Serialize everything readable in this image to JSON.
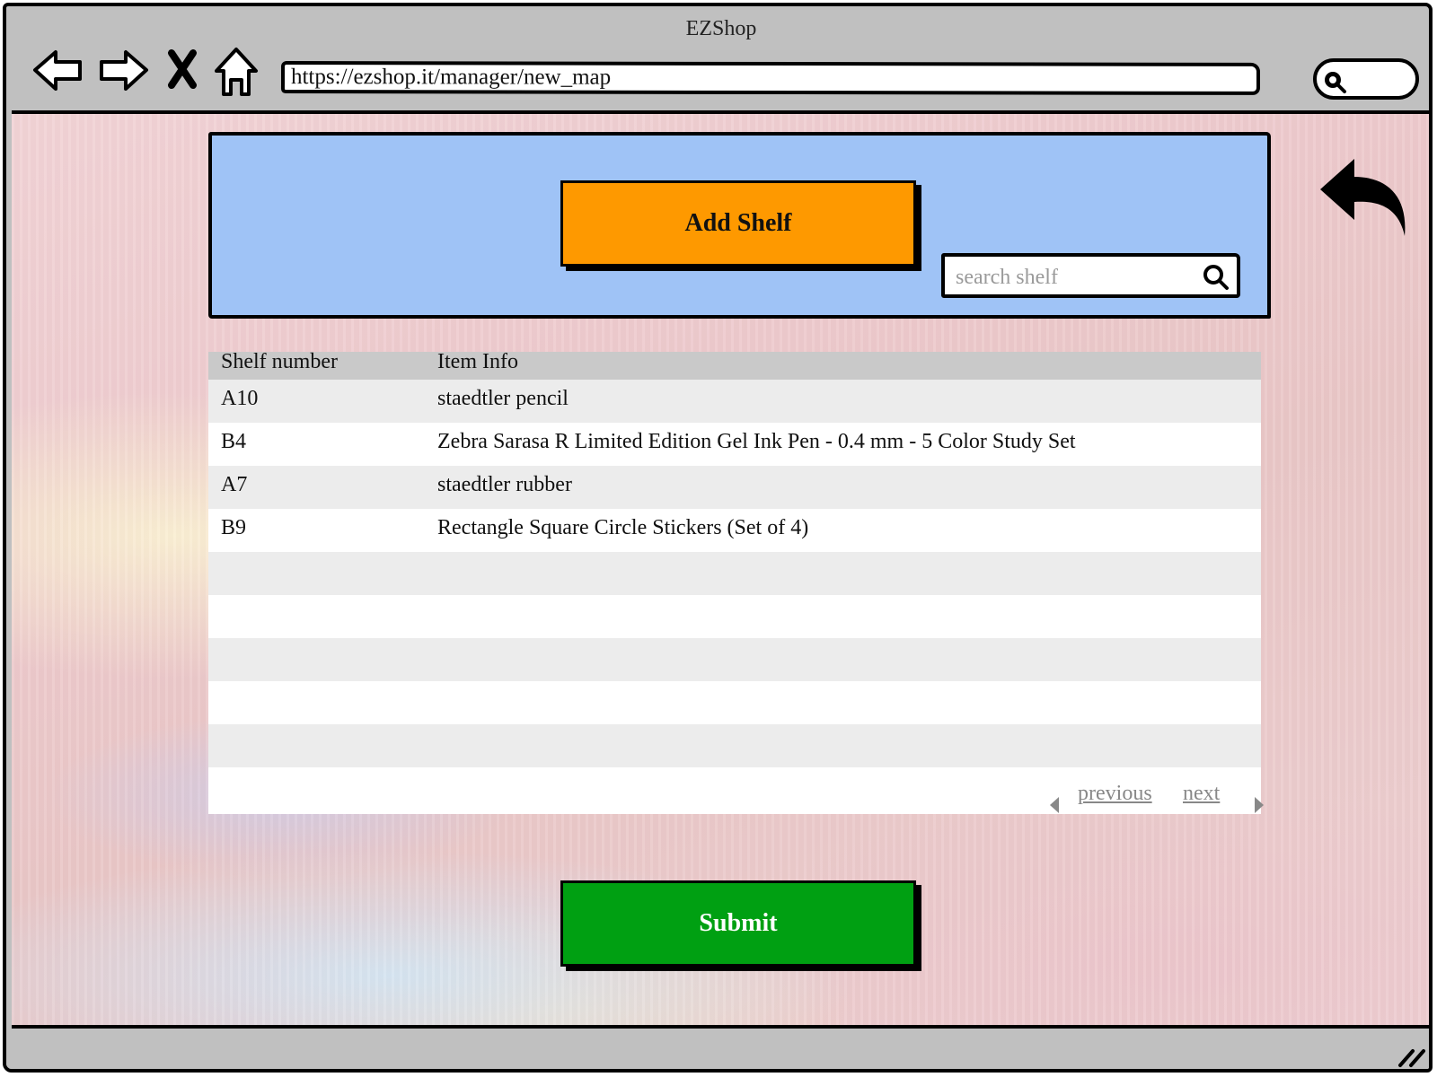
{
  "browser": {
    "title": "EZShop",
    "url": "https://ezshop.it/manager/new_map",
    "nav_icons": [
      "back-arrow-icon",
      "forward-arrow-icon",
      "close-x-icon",
      "home-icon"
    ]
  },
  "header": {
    "add_shelf_label": "Add Shelf",
    "search_placeholder": "search shelf",
    "search_value": ""
  },
  "table": {
    "columns": [
      "Shelf number",
      "Item Info"
    ],
    "rows": [
      {
        "shelf": "A10",
        "item": "staedtler pencil"
      },
      {
        "shelf": "B4",
        "item": "Zebra Sarasa R Limited Edition Gel Ink Pen - 0.4 mm - 5 Color Study Set"
      },
      {
        "shelf": "A7",
        "item": "staedtler rubber"
      },
      {
        "shelf": "B9",
        "item": "Rectangle Square Circle Stickers (Set of 4)"
      },
      {
        "shelf": "",
        "item": ""
      },
      {
        "shelf": "",
        "item": ""
      },
      {
        "shelf": "",
        "item": ""
      },
      {
        "shelf": "",
        "item": ""
      },
      {
        "shelf": "",
        "item": ""
      },
      {
        "shelf": "",
        "item": ""
      }
    ],
    "pager": {
      "previous": "previous",
      "next": "next"
    }
  },
  "footer": {
    "submit_label": "Submit"
  },
  "colors": {
    "header_panel": "#9fc3f6",
    "add_button": "#fe9900",
    "submit_button": "#00a012",
    "chrome": "#c0c0c0"
  }
}
